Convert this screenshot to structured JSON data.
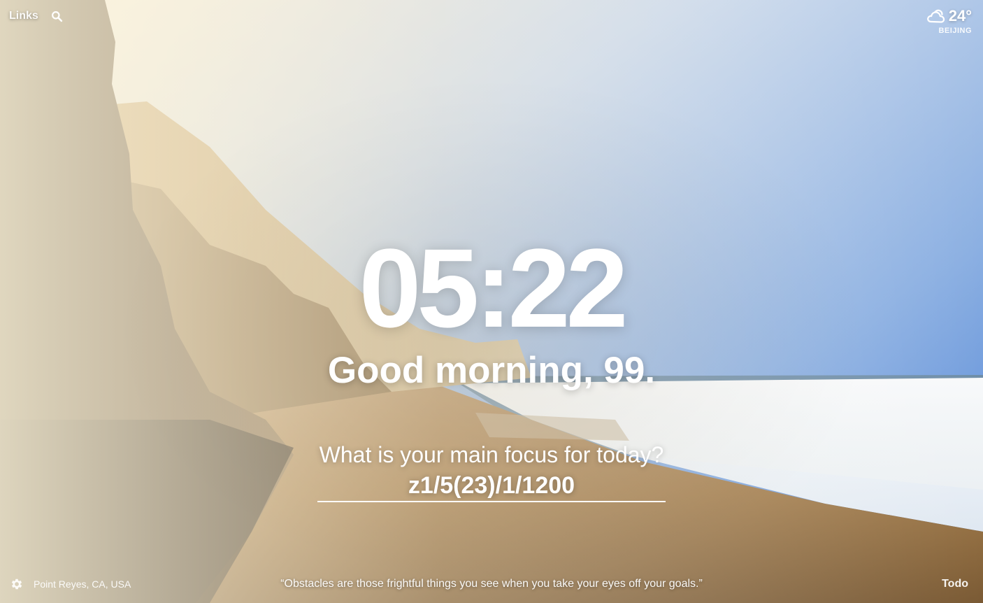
{
  "top_left": {
    "links_label": "Links",
    "search_icon": "search-icon"
  },
  "weather": {
    "icon": "cloud-icon",
    "temperature": "24°",
    "city": "BEIJING"
  },
  "clock": {
    "time": "05:22"
  },
  "greeting": {
    "text": "Good morning, 99."
  },
  "focus": {
    "question": "What is your main focus for today?",
    "value": "z1/5(23)/1/1200"
  },
  "footer": {
    "settings_icon": "gear-icon",
    "photo_location": "Point Reyes, CA, USA",
    "quote": "“Obstacles are those frightful things you see when you take your eyes off your goals.”",
    "todo_label": "Todo"
  },
  "colors": {
    "text": "#ffffff",
    "sky_top": "#5b8fd9",
    "sand": "#a07a4a",
    "cliff": "#3b2e22"
  }
}
